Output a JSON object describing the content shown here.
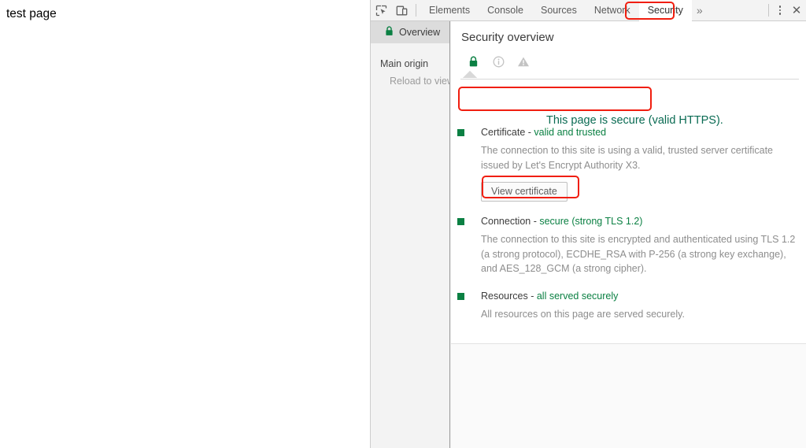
{
  "page": {
    "title_text": "test page"
  },
  "devtools": {
    "toolbar": {
      "inspect_icon": "inspect-element-icon",
      "device_icon": "device-toolbar-icon",
      "tabs": [
        {
          "label": "Elements",
          "active": false
        },
        {
          "label": "Console",
          "active": false
        },
        {
          "label": "Sources",
          "active": false
        },
        {
          "label": "Network",
          "active": false
        },
        {
          "label": "Security",
          "active": true
        }
      ],
      "more_tabs_glyph": "»",
      "more_options_icon": "kebab-menu-icon",
      "close_icon": "close-icon",
      "close_glyph": "✕"
    },
    "sidebar": {
      "overview_label": "Overview",
      "overview_icon": "green-lock-icon",
      "group_title": "Main origin",
      "sub_item": "Reload to view"
    },
    "main": {
      "title": "Security overview",
      "state_icons": [
        {
          "name": "lock-icon",
          "state": "secure"
        },
        {
          "name": "info-icon",
          "state": "inactive"
        },
        {
          "name": "warning-triangle-icon",
          "state": "inactive"
        }
      ],
      "summary_banner": "This page is secure (valid HTTPS).",
      "explanations": [
        {
          "id": "certificate",
          "title_prefix": "Certificate - ",
          "title_status": "valid and trusted",
          "description": "The connection to this site is using a valid, trusted server certificate issued by Let's Encrypt Authority X3.",
          "button_label": "View certificate"
        },
        {
          "id": "connection",
          "title_prefix": "Connection - ",
          "title_status": "secure (strong TLS 1.2)",
          "description": "The connection to this site is encrypted and authenticated using TLS 1.2 (a strong protocol), ECDHE_RSA with P-256 (a strong key exchange), and AES_128_GCM (a strong cipher)."
        },
        {
          "id": "resources",
          "title_prefix": "Resources - ",
          "title_status": "all served securely",
          "description": "All resources on this page are served securely."
        }
      ]
    }
  },
  "colors": {
    "secure_green": "#0b8043",
    "banner_text": "#0a6b53",
    "highlight_red": "#f01e0f",
    "toolbar_bg": "#f3f3f3",
    "sidebar_selected": "#dcdcdc",
    "muted_text": "#8d8d8d"
  }
}
